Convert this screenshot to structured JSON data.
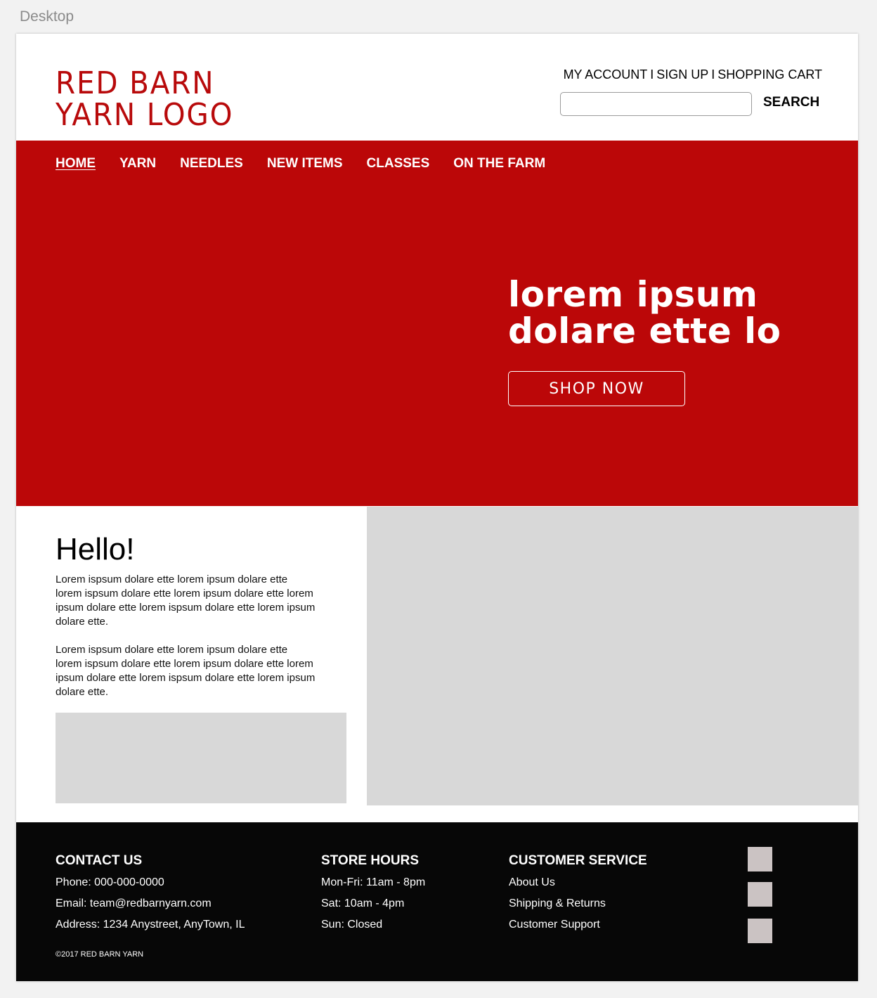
{
  "canvas": {
    "label": "Desktop"
  },
  "header": {
    "logo_line1": "RED BARN",
    "logo_line2": "YARN LOGO",
    "account_links": [
      {
        "label": "MY ACCOUNT"
      },
      {
        "label": "SIGN UP"
      },
      {
        "label": "SHOPPING CART"
      }
    ],
    "link_separator": "I",
    "search": {
      "value": "",
      "placeholder": "",
      "button_label": "SEARCH"
    }
  },
  "nav": {
    "items": [
      {
        "label": "HOME",
        "active": true
      },
      {
        "label": "YARN",
        "active": false
      },
      {
        "label": "NEEDLES",
        "active": false
      },
      {
        "label": "NEW ITEMS",
        "active": false
      },
      {
        "label": "CLASSES",
        "active": false
      },
      {
        "label": "ON THE FARM",
        "active": false
      }
    ]
  },
  "hero": {
    "headline_line1": "lorem ipsum",
    "headline_line2": "dolare ette lo",
    "cta_label": "SHOP NOW",
    "background_color": "#bb0708"
  },
  "intro": {
    "title": "Hello!",
    "paragraph1": "Lorem ispsum dolare ette lorem ipsum dolare ette lorem ispsum dolare ette lorem ipsum dolare ette lorem ipsum dolare ette lorem ispsum dolare ette lorem ipsum dolare ette.",
    "paragraph2": "Lorem ispsum dolare ette lorem ipsum dolare ette lorem ispsum dolare ette lorem ipsum dolare ette lorem ipsum dolare ette lorem ispsum dolare ette lorem ipsum dolare ette."
  },
  "footer": {
    "contact": {
      "heading": "CONTACT US",
      "phone": "Phone: 000-000-0000",
      "email": "Email: team@redbarnyarn.com",
      "address": "Address: 1234 Anystreet, AnyTown, IL"
    },
    "hours": {
      "heading": "STORE HOURS",
      "lines": [
        "Mon-Fri: 11am - 8pm",
        "Sat: 10am - 4pm",
        "Sun: Closed"
      ]
    },
    "service": {
      "heading": "CUSTOMER SERVICE",
      "links": [
        "About Us",
        "Shipping & Returns",
        "Customer Support"
      ]
    },
    "copyright": "©2017 RED BARN YARN"
  },
  "colors": {
    "brand_red": "#bb0708",
    "logo_red": "#b80a0b",
    "placeholder_gray": "#d8d8d8",
    "footer_bg": "#070707",
    "social_placeholder": "#cbc3c3"
  }
}
